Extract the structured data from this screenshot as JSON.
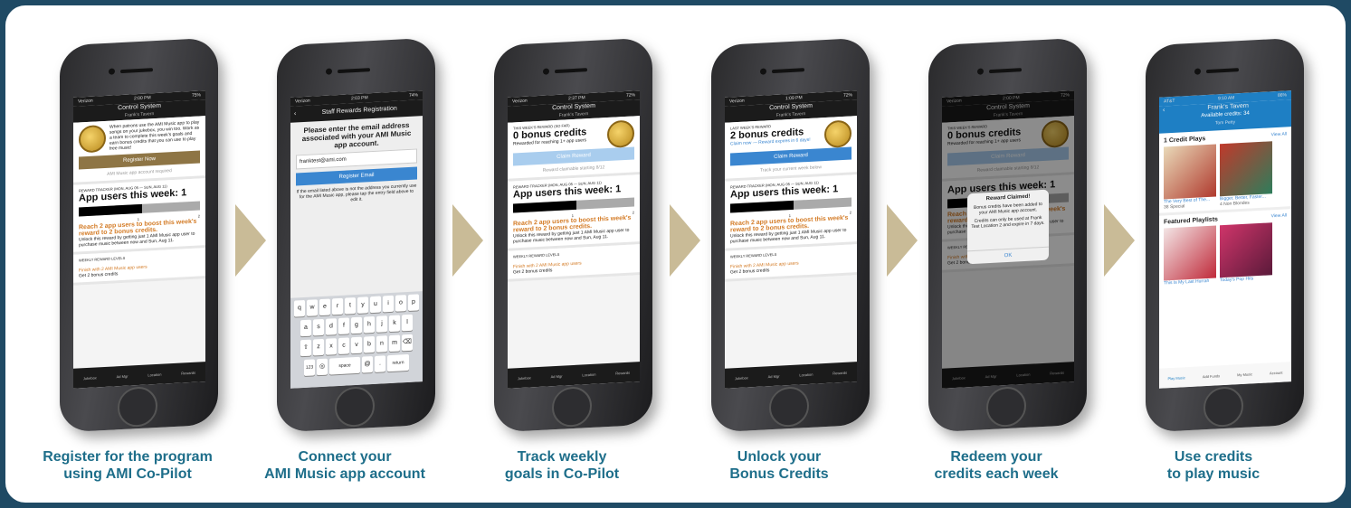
{
  "colors": {
    "border": "#1f4a64",
    "caption": "#1e6e8a",
    "gold": "#8e7545",
    "blue": "#3a86d0",
    "orange": "#d37a24"
  },
  "captions": [
    {
      "line1": "Register for the program",
      "line2": "using AMI Co-Pilot"
    },
    {
      "line1": "Connect your",
      "line2": "AMI Music app account"
    },
    {
      "line1": "Track weekly",
      "line2": "goals in Co-Pilot"
    },
    {
      "line1": "Unlock your",
      "line2": "Bonus Credits"
    },
    {
      "line1": "Redeem your",
      "line2": "credits each week"
    },
    {
      "line1": "Use credits",
      "line2": "to play music"
    }
  ],
  "s1": {
    "carrier": "Verizon",
    "time": "2:00 PM",
    "battery": "75%",
    "title": "Control System",
    "sub": "Frank's Tavern",
    "intro": "When patrons use the AMI Music app to play songs on your jukebox, you win too. Work as a team to complete this week's goals and earn bonus credits that you can use to play free music!",
    "btn": "Register Now",
    "hint": "AMI Music app account required",
    "tracker": "REWARD TRACKER (MON, AUG 05 — SUN, AUG 11)",
    "users": "App users this week: 1",
    "tick1": "1",
    "tick2": "2",
    "goal": "Reach 2 app users to boost this week's reward to 2 bonus credits.",
    "desc": "Unlock this reward by getting just 1 AMI Music app user to purchase music between now and Sun, Aug 11.",
    "levels": "WEEKLY REWARD LEVELS",
    "lvl1": "Finish with 2 AMI Music app users",
    "lvl1b": "Get 2 bonus credits"
  },
  "s2": {
    "carrier": "Verizon",
    "time": "2:03 PM",
    "battery": "74%",
    "title": "Staff Rewards Registration",
    "prompt": "Please enter the email address associated with your AMI Music app account.",
    "email": "franktest@ami.com",
    "btn": "Register Email",
    "note": "If the email listed above is not the address you currently use for the AMI Music app, please tap the entry field above to edit it.",
    "row1": [
      "q",
      "w",
      "e",
      "r",
      "t",
      "y",
      "u",
      "i",
      "o",
      "p"
    ],
    "row2": [
      "a",
      "s",
      "d",
      "f",
      "g",
      "h",
      "j",
      "k",
      "l"
    ],
    "row3": [
      "z",
      "x",
      "c",
      "v",
      "b",
      "n",
      "m"
    ],
    "k123": "123",
    "space": "space",
    "at": "@",
    "dot": ".",
    "ret": "return"
  },
  "s3": {
    "carrier": "Verizon",
    "time": "2:37 PM",
    "battery": "72%",
    "title": "Control System",
    "sub": "Frank's Tavern",
    "week": "THIS WEEK'S REWARD (SO FAR)",
    "credits": "0 bonus credits",
    "reason": "Rewarded for reaching 1+ app users",
    "btn": "Claim Reward",
    "hint": "Reward claimable starting 8/12",
    "tracker": "REWARD TRACKER (MON, AUG 05 — SUN, AUG 11)",
    "users": "App users this week: 1",
    "tick1": "1",
    "tick2": "2",
    "goal": "Reach 2 app users to boost this week's reward to 2 bonus credits.",
    "desc": "Unlock this reward by getting just 1 AMI Music app user to purchase music between now and Sun, Aug 11.",
    "levels": "WEEKLY REWARD LEVELS",
    "lvl1": "Finish with 2 AMI Music app users",
    "lvl1b": "Get 2 bonus credits"
  },
  "s4": {
    "carrier": "Verizon",
    "time": "1:09 PM",
    "battery": "72%",
    "title": "Control System",
    "sub": "Frank's Tavern",
    "week": "LAST WEEK'S REWARD",
    "credits": "2 bonus credits",
    "reason": "Claim now — Reward expires in 6 days!",
    "btn": "Claim Reward",
    "hint": "Track your current week below",
    "tracker": "REWARD TRACKER (MON, AUG 05 — SUN, AUG 11)",
    "users": "App users this week: 1",
    "tick1": "1",
    "tick2": "2",
    "goal": "Reach 2 app users to boost this week's reward to 2 bonus credits.",
    "desc": "Unlock this reward by getting just 1 AMI Music app user to purchase music between now and Sun, Aug 11.",
    "levels": "WEEKLY REWARD LEVELS",
    "lvl1": "Finish with 2 AMI Music app users",
    "lvl1b": "Get 2 bonus credits"
  },
  "s5": {
    "carrier": "Verizon",
    "time": "2:00 PM",
    "battery": "72%",
    "title": "Control System",
    "sub": "Frank's Tavern",
    "week": "THIS WEEK'S REWARD",
    "credits": "0 bonus credits",
    "reason": "Rewarded for reaching 1+ app users",
    "btn": "Claim Reward",
    "hint": "Reward claimable starting 8/12",
    "users": "App users this week: 1",
    "goal": "Reach 2 app users to boost this week's reward to 2 bonus credits.",
    "desc": "Unlock this reward by getting just 1 AMI Music app user to purchase music between now and Sun, Aug 11.",
    "levels": "WEEKLY REWARD LEVELS",
    "lvl1": "Finish with 2 AMI Music app users",
    "lvl1b": "Get 2 bonus credits",
    "alert_title": "Reward Claimed!",
    "alert_body": "Bonus credits have been added to your AMI Music app account.",
    "alert_note": "Credits can only be used at Frank Test Location 2 and expire in 7 days.",
    "alert_ok": "OK"
  },
  "s6": {
    "carrier": "AT&T",
    "time": "9:10 AM",
    "battery": "86%",
    "title": "Frank's Tavern",
    "credits": "Available credits: 34",
    "now": "Tom Petty",
    "sec1": "1 Credit Plays",
    "viewall": "View All",
    "a1": "The Very Best of The...",
    "a1b": "38 Special",
    "a2": "Bigger, Better, Faster...",
    "a2b": "4 Non Blondes",
    "sec2": "Featured Playlists",
    "p1": "This Is My Last Hurrah",
    "p2": "Today's Pop Hits",
    "tabs": [
      "Play Music",
      "Add Funds",
      "My Music",
      "Account"
    ]
  },
  "tabs": [
    "Jukebox",
    "Ad Mgr",
    "Location",
    "Rewards"
  ]
}
